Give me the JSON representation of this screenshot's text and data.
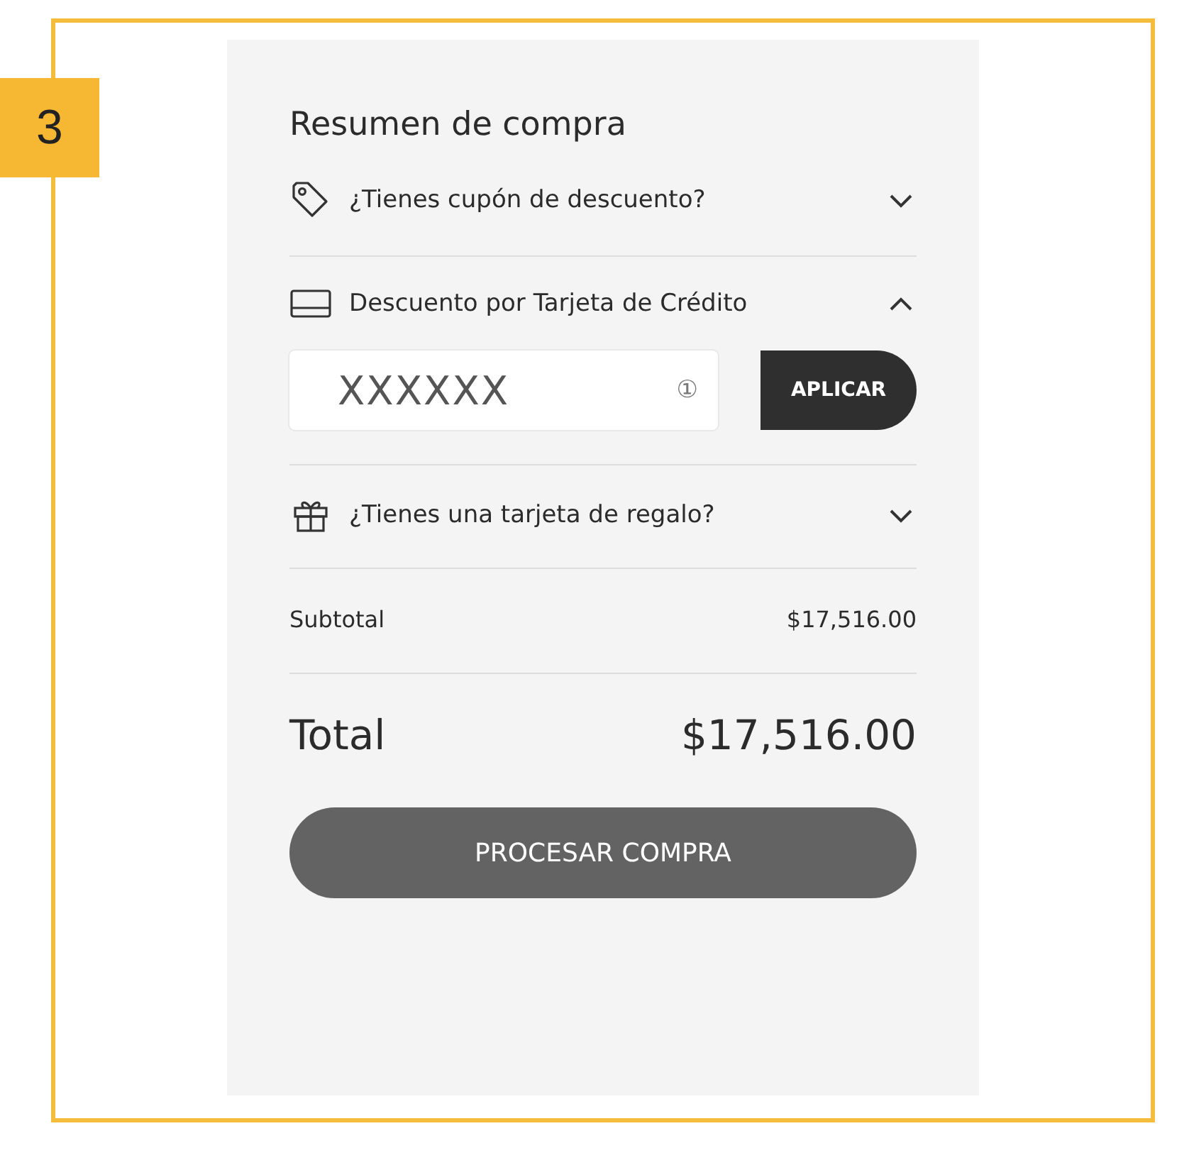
{
  "step_badge": "3",
  "summary": {
    "title": "Resumen de compra",
    "sections": [
      {
        "kind": "tag",
        "label": "¿Tienes cupón de descuento?",
        "expanded": false
      },
      {
        "kind": "card",
        "label": "Descuento por Tarjeta de Crédito",
        "expanded": true,
        "field": {
          "value": "XXXXXX",
          "info": "①"
        },
        "button": "APLICAR"
      },
      {
        "kind": "gift",
        "label": "¿Tienes una tarjeta de regalo?",
        "expanded": false
      }
    ],
    "subtotal": {
      "label": "Subtotal",
      "amount": "$17,516.00"
    },
    "total": {
      "label": "Total",
      "amount": "$17,516.00"
    },
    "submit": "PROCESAR COMPRA"
  }
}
